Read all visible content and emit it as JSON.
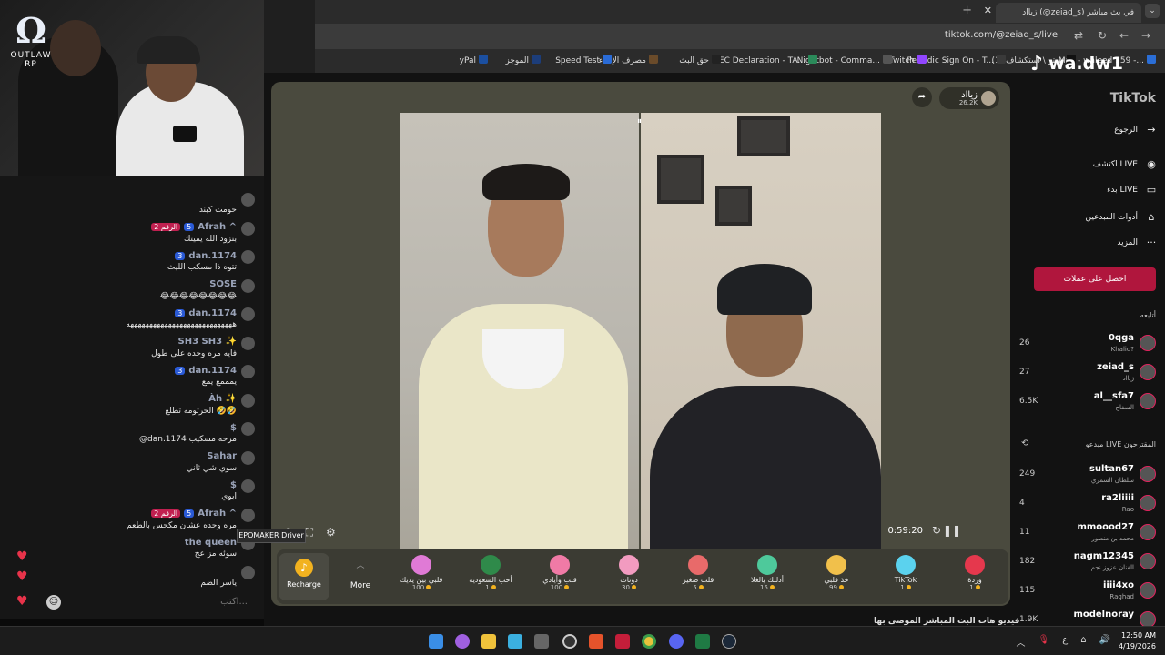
{
  "webcam": {
    "logo_text": "OUTLAW RP"
  },
  "chat": {
    "messages": [
      {
        "name": "",
        "level": "",
        "badge": "",
        "text": "حومت كبند"
      },
      {
        "name": "Afrah ^",
        "level": "5",
        "badge": "2 الرقم",
        "text": "بتزود الله يميتك"
      },
      {
        "name": "dan.1174",
        "level": "3",
        "badge": "",
        "text": "تتوه ذا مسكب الليث"
      },
      {
        "name": "SOSE",
        "level": "",
        "badge": "",
        "text": "😂😂😂😂😂😂😂😂"
      },
      {
        "name": "dan.1174",
        "level": "3",
        "badge": "",
        "text": "ههههههههههههههههههههههههههههه"
      },
      {
        "name": "SH3 SH3 ✨",
        "level": "",
        "badge": "",
        "text": "فايه مره وحده على طول"
      },
      {
        "name": "dan.1174",
        "level": "3",
        "badge": "",
        "text": "يمممع يمع"
      },
      {
        "name": "Àh ✨",
        "level": "",
        "badge": "",
        "text": "الحرثومه تطلع 🤣🤣"
      },
      {
        "name": "$",
        "level": "",
        "badge": "",
        "text": "@dan.1174 مرحه مسكيب"
      },
      {
        "name": "Sahar",
        "level": "",
        "badge": "",
        "text": "سوي شي ثاني"
      },
      {
        "name": "$",
        "level": "",
        "badge": "",
        "text": "ابوي"
      },
      {
        "name": "Afrah ^",
        "level": "5",
        "badge": "2 الرقم",
        "text": "مره وحده عشان مكحس بالطعم"
      },
      {
        "name": "the queen",
        "level": "",
        "badge": "",
        "text": "سوئه مز عج"
      },
      {
        "name": "",
        "level": "",
        "badge": "",
        "text": "ياسر الضم"
      }
    ],
    "input_placeholder": "اكتب..."
  },
  "browser": {
    "active_tab_title": "زيااد (@zeiad_s) في بث مباشر",
    "url": "tiktok.com/@zeiad_s/live",
    "bookmarks": [
      {
        "label": "Mail - waleed 159 -...",
        "color": "#2b6ed6"
      },
      {
        "label": "(1) تويتر \\ استكشاف",
        "color": "#111111"
      },
      {
        "label": "Periodic Sign On - T...",
        "color": "#3a3a3a"
      },
      {
        "label": "Twitch",
        "color": "#9146ff"
      },
      {
        "label": "Nightbot - Comma...",
        "color": "#555555"
      },
      {
        "label": "EC Declaration - TA...",
        "color": "#2b8a5a"
      },
      {
        "label": "حق البث",
        "color": "#222222"
      },
      {
        "label": "مصرف الإنماء",
        "color": "#6a4b2a"
      },
      {
        "label": "Speed Test",
        "color": "#2a6bd6"
      },
      {
        "label": "الموجز",
        "color": "#1c3d7a"
      },
      {
        "label": "yPal",
        "color": "#1b4fa0"
      }
    ]
  },
  "live": {
    "host_name": "زيااد",
    "host_likes": "26.2K",
    "timer": "0:59:20",
    "tooltip": "EPOMAKER Driver",
    "footer": "فيديو هات البث المباشر الموصى بها",
    "recharge_label": "Recharge",
    "more_label": "More",
    "gifts": [
      {
        "name": "وردة",
        "price": "1",
        "color": "#e5384d"
      },
      {
        "name": "TikTok",
        "price": "1",
        "color": "#5bd2ee"
      },
      {
        "name": "خذ قلبي",
        "price": "99",
        "color": "#f1c04b"
      },
      {
        "name": "أدللك يالغلا",
        "price": "15",
        "color": "#4ec99b"
      },
      {
        "name": "قلب صغير",
        "price": "5",
        "color": "#e86a6a"
      },
      {
        "name": "دونات",
        "price": "30",
        "color": "#f29bc0"
      },
      {
        "name": "قلب وأيادي",
        "price": "100",
        "color": "#f07aa6"
      },
      {
        "name": "أحب السعودية",
        "price": "1",
        "color": "#2f8a4a"
      },
      {
        "name": "قلبي بين يديك",
        "price": "100",
        "color": "#e07ad6"
      }
    ]
  },
  "sidebar": {
    "logo": "TikTok",
    "nav": [
      {
        "label": "الرجوع",
        "icon": "→"
      },
      {
        "label": "اكتشف LIVE",
        "icon": "◉"
      },
      {
        "label": "بدء LIVE",
        "icon": "▭"
      },
      {
        "label": "أدوات المبدعين",
        "icon": "⌂"
      },
      {
        "label": "المزيد",
        "icon": "···"
      }
    ],
    "coins_button": "احصل على عملات",
    "following_title": "أتابعه",
    "following": [
      {
        "count": "26",
        "name": "0qga",
        "sub": "Khalid?"
      },
      {
        "count": "27",
        "name": "zeiad_s",
        "sub": "زيااد"
      },
      {
        "count": "6.5K",
        "name": "al__sfa7",
        "sub": "السفاح"
      }
    ],
    "suggested_title": "مبدعو LIVE المقترحون",
    "suggested": [
      {
        "count": "249",
        "name": "sultan67",
        "sub": "سلطان الشمري"
      },
      {
        "count": "4",
        "name": "ra2liiii",
        "sub": "Rao"
      },
      {
        "count": "11",
        "name": "mmoood27",
        "sub": "محمد بن منصور"
      },
      {
        "count": "182",
        "name": "nagm12345",
        "sub": "الفنان عزوز نجم"
      },
      {
        "count": "115",
        "name": "iiii4xo",
        "sub": "Raghad"
      },
      {
        "count": "1.9K",
        "name": "modelnoray",
        "sub": ""
      }
    ]
  },
  "overlay": {
    "handle": "wa.dw1"
  },
  "taskbar": {
    "time": "12:50 AM",
    "date": "4/19/2026",
    "lang": "ع"
  }
}
